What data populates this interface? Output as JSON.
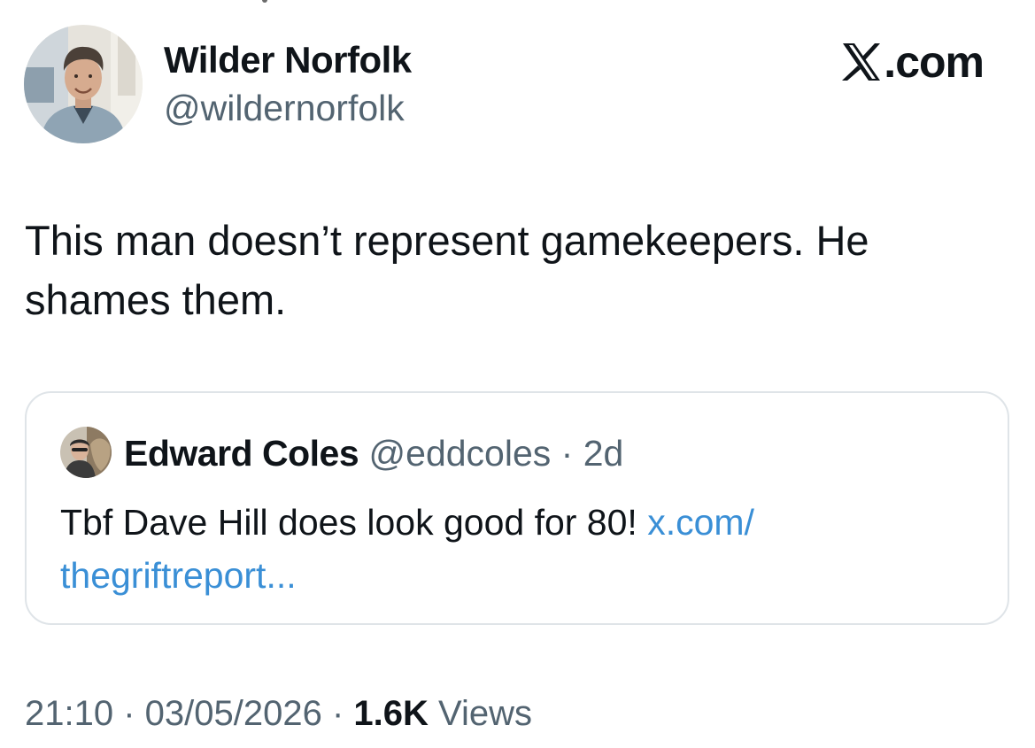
{
  "author": {
    "display_name": "Wilder Norfolk",
    "handle": "@wildernorfolk",
    "avatar": "profile-photo"
  },
  "brand": {
    "icon": "x-logo-icon",
    "text": ".com"
  },
  "tweet": {
    "text": "This man doesn’t represent gamekeepers. He shames them."
  },
  "quoted_tweet": {
    "display_name": "Edward Coles",
    "handle": "@eddcoles",
    "separator": " · ",
    "time": "2d",
    "text": "Tbf Dave Hill does look good for 80! ",
    "link_text": "x.com/ thegriftreport...",
    "avatar": "profile-photo",
    "link_color": "#3a8fd6"
  },
  "meta": {
    "time": "21:10",
    "sep1": " · ",
    "date": "03/05/2026",
    "sep2": " · ",
    "views_count": "1.6K",
    "views_label": " Views"
  },
  "colors": {
    "primary_text": "#0f1419",
    "secondary_text": "#536471",
    "card_border": "#dfe4e8",
    "background": "#ffffff"
  }
}
